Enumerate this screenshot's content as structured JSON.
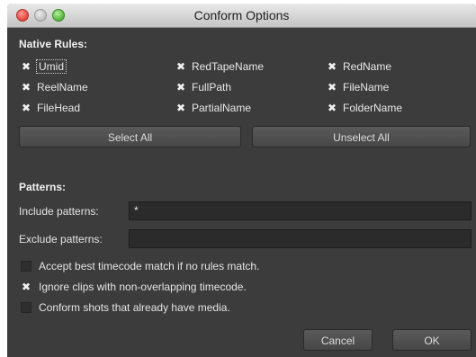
{
  "window": {
    "title": "Conform Options"
  },
  "native_rules": {
    "heading": "Native Rules:",
    "items": [
      {
        "label": "Umid",
        "checked": true
      },
      {
        "label": "RedTapeName",
        "checked": true
      },
      {
        "label": "RedName",
        "checked": true
      },
      {
        "label": "ReelName",
        "checked": true
      },
      {
        "label": "FullPath",
        "checked": true
      },
      {
        "label": "FileName",
        "checked": true
      },
      {
        "label": "FileHead",
        "checked": true
      },
      {
        "label": "PartialName",
        "checked": true
      },
      {
        "label": "FolderName",
        "checked": true
      }
    ],
    "select_all": "Select All",
    "unselect_all": "Unselect All"
  },
  "patterns": {
    "heading": "Patterns:",
    "include_label": "Include patterns:",
    "include_value": "*",
    "exclude_label": "Exclude patterns:",
    "exclude_value": ""
  },
  "options": [
    {
      "label": "Accept best timecode match if no rules match.",
      "checked": false
    },
    {
      "label": "Ignore clips with non-overlapping timecode.",
      "checked": true
    },
    {
      "label": "Conform shots that already have media.",
      "checked": false
    }
  ],
  "footer": {
    "cancel": "Cancel",
    "ok": "OK"
  },
  "check_glyph": "✖"
}
